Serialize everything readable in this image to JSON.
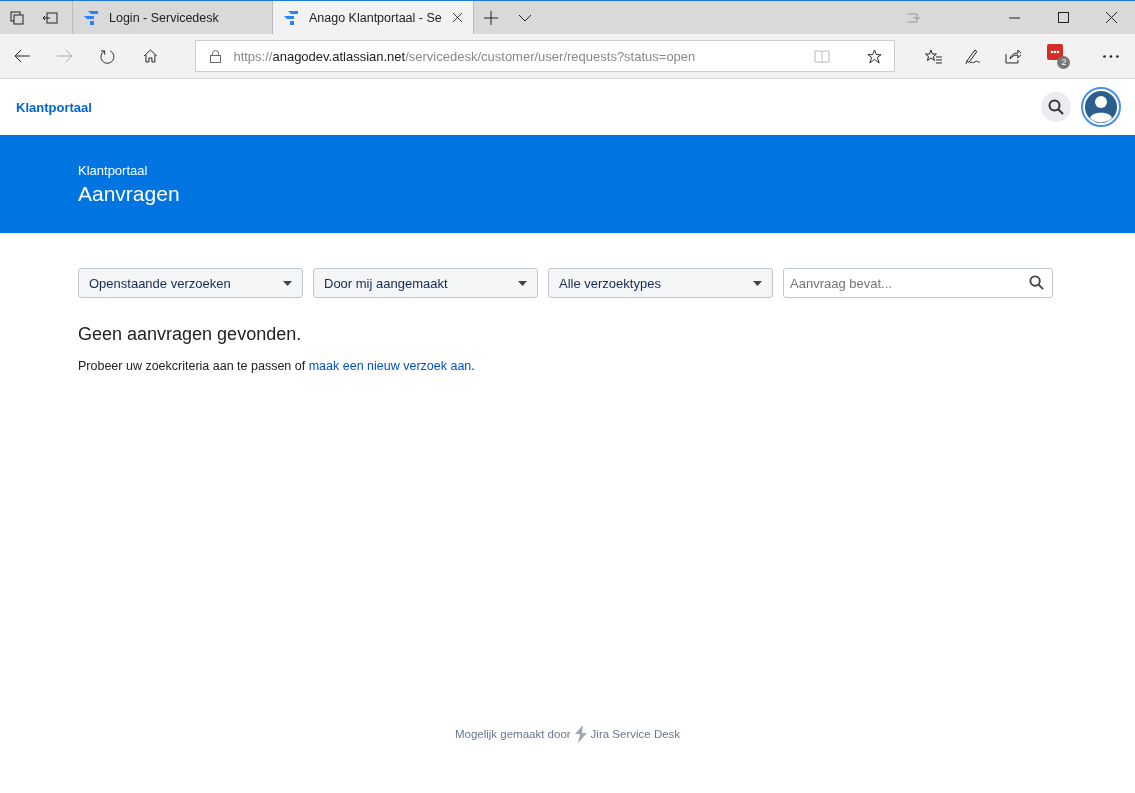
{
  "browser": {
    "tabs": [
      {
        "title": "Login - Servicedesk",
        "selected": false
      },
      {
        "title": "Anago Klantportaal - Se",
        "selected": true
      }
    ],
    "address": {
      "scheme": "https://",
      "host": "anagodev.atlassian.net",
      "path": "/servicedesk/customer/user/requests?status=open"
    },
    "extension_badge": "2"
  },
  "header": {
    "brand": "Klantportaal"
  },
  "banner": {
    "breadcrumb": "Klantportaal",
    "title": "Aanvragen"
  },
  "filters": [
    {
      "value": "Openstaande verzoeken"
    },
    {
      "value": "Door mij aangemaakt"
    },
    {
      "value": "Alle verzoektypes"
    }
  ],
  "search": {
    "placeholder": "Aanvraag bevat..."
  },
  "empty": {
    "heading": "Geen aanvragen gevonden.",
    "text": "Probeer uw zoekcriteria aan te passen of ",
    "link": "maak een nieuw verzoek aan",
    "after": "."
  },
  "footer": {
    "text": "Mogelijk gemaakt door",
    "product": "Jira Service Desk"
  }
}
